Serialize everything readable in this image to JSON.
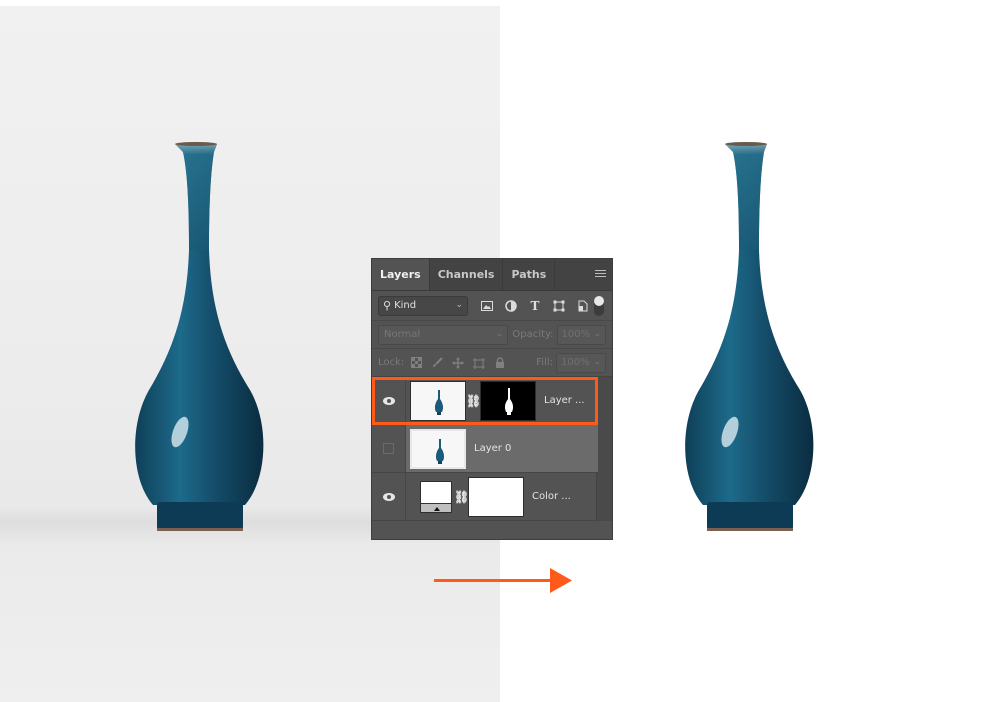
{
  "colors": {
    "accent": "#ff5a1a",
    "panel_bg": "#535353",
    "vase_blue": "#1b5a78",
    "before_bg": "#eeeeee",
    "after_bg": "#ffffff"
  },
  "images": {
    "before": {
      "subject": "blue-vase-on-gray-background"
    },
    "after": {
      "subject": "blue-vase-on-white-background"
    }
  },
  "panel": {
    "tabs": [
      {
        "label": "Layers",
        "active": true
      },
      {
        "label": "Channels",
        "active": false
      },
      {
        "label": "Paths",
        "active": false
      }
    ],
    "menu_icon": "hamburger-menu-icon",
    "filter": {
      "kind_label": "Kind",
      "icons": [
        "image-filter-icon",
        "adjustment-filter-icon",
        "type-filter-icon",
        "shape-filter-icon",
        "smart-object-filter-icon"
      ]
    },
    "blend": {
      "mode": "Normal",
      "opacity_label": "Opacity:",
      "opacity_value": "100%"
    },
    "lock": {
      "label": "Lock:",
      "icons": [
        "lock-transparent-icon",
        "lock-paint-icon",
        "lock-move-icon",
        "lock-artboard-icon",
        "lock-all-icon"
      ],
      "fill_label": "Fill:",
      "fill_value": "100%"
    },
    "layers": [
      {
        "name": "Layer ...",
        "visible": true,
        "selected": true,
        "has_mask": true,
        "mask_type": "vase-silhouette"
      },
      {
        "name": "Layer 0",
        "visible": false,
        "selected": false,
        "has_mask": false
      },
      {
        "name": "Color ...",
        "visible": true,
        "selected": false,
        "has_mask": true,
        "mask_type": "white",
        "type": "color-fill"
      }
    ]
  },
  "arrow": {
    "direction": "right",
    "meaning": "before-to-after"
  }
}
